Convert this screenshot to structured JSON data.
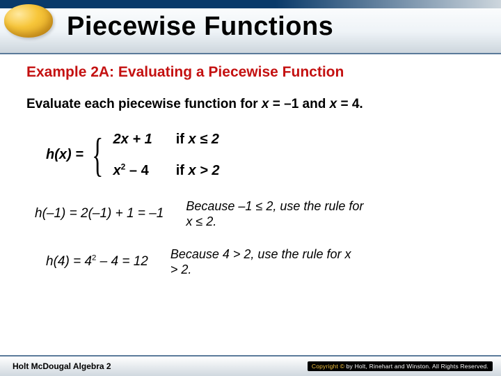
{
  "header": {
    "title": "Piecewise Functions"
  },
  "example": {
    "heading": "Example 2A: Evaluating a Piecewise Function",
    "instruction_prefix": "Evaluate each piecewise function for ",
    "instruction_var1": "x",
    "instruction_eq1": " = –1 and ",
    "instruction_var2": "x",
    "instruction_eq2": " = 4."
  },
  "piecewise": {
    "lhs": "h(x) =",
    "case1_expr": "2x + 1",
    "case1_cond_if": "if ",
    "case1_cond": "x ≤ 2",
    "case2_expr_pre": "x",
    "case2_expr_sup": "2",
    "case2_expr_post": " – 4",
    "case2_cond_if": "if ",
    "case2_cond": "x > 2"
  },
  "work": [
    {
      "calc": "h(–1) = 2(–1) + 1 = –1",
      "reason": "Because –1 ≤ 2, use the rule for x ≤ 2."
    },
    {
      "calc_pre": "h(4) = 4",
      "calc_sup": "2",
      "calc_post": " – 4 = 12",
      "reason": "Because 4 > 2, use the rule for x > 2."
    }
  ],
  "footer": {
    "textbook": "Holt McDougal Algebra 2",
    "copyright": "Copyright © by Holt, Rinehart and Winston. All Rights Reserved."
  },
  "chart_data": {
    "type": "table",
    "title": "Piecewise function h(x) evaluated at x = -1 and x = 4",
    "function": {
      "name": "h(x)",
      "pieces": [
        {
          "expression": "2x + 1",
          "condition": "x ≤ 2"
        },
        {
          "expression": "x^2 - 4",
          "condition": "x > 2"
        }
      ]
    },
    "evaluations": [
      {
        "x": -1,
        "rule_used": "2x + 1",
        "result": -1
      },
      {
        "x": 4,
        "rule_used": "x^2 - 4",
        "result": 12
      }
    ]
  }
}
